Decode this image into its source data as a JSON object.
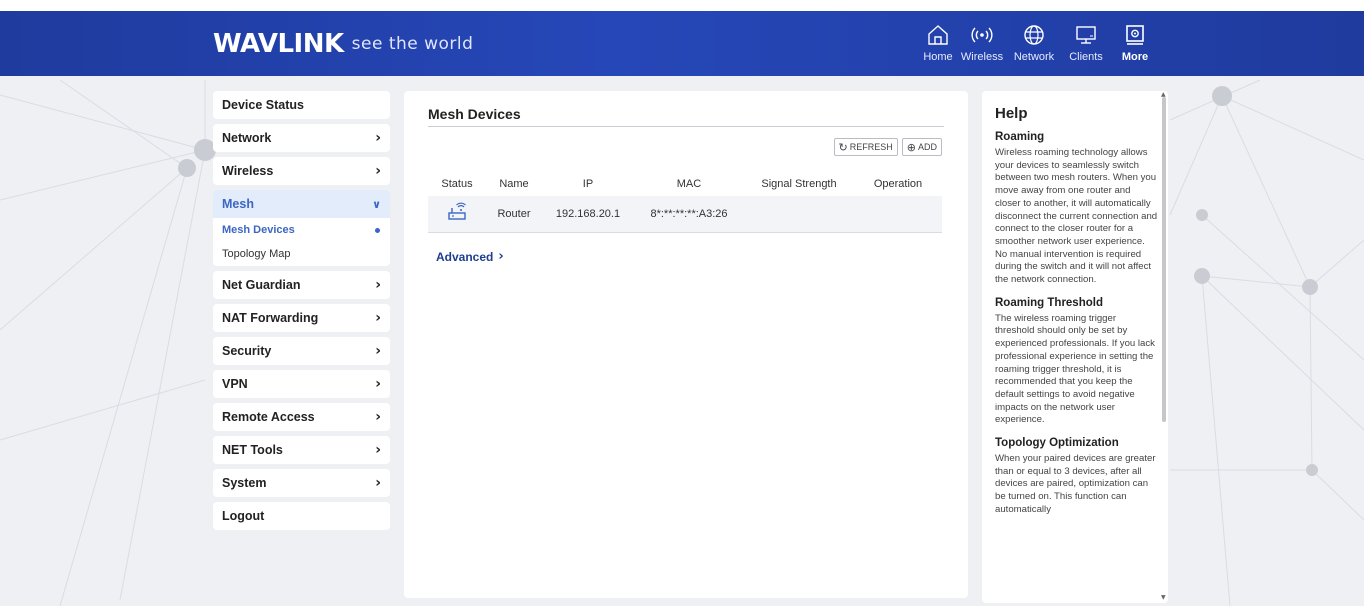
{
  "brand": {
    "logo": "WAVLINK",
    "slogan": "see the world"
  },
  "topnav": [
    {
      "label": "Home",
      "icon": "home-icon",
      "active": false
    },
    {
      "label": "Wireless",
      "icon": "wireless-icon",
      "active": false
    },
    {
      "label": "Network",
      "icon": "globe-icon",
      "active": false
    },
    {
      "label": "Clients",
      "icon": "monitor-icon",
      "active": false
    },
    {
      "label": "More",
      "icon": "more-icon",
      "active": true
    }
  ],
  "sidebar": {
    "device_status": "Device Status",
    "network": "Network",
    "wireless": "Wireless",
    "mesh": "Mesh",
    "mesh_devices": "Mesh Devices",
    "topology_map": "Topology Map",
    "net_guardian": "Net Guardian",
    "nat_forwarding": "NAT Forwarding",
    "security": "Security",
    "vpn": "VPN",
    "remote_access": "Remote Access",
    "net_tools": "NET Tools",
    "system": "System",
    "logout": "Logout"
  },
  "main": {
    "title": "Mesh Devices",
    "refresh_label": "REFRESH",
    "add_label": "ADD",
    "columns": [
      "Status",
      "Name",
      "IP",
      "MAC",
      "Signal Strength",
      "Operation"
    ],
    "rows": [
      {
        "status_icon": "router-icon",
        "name": "Router",
        "ip": "192.168.20.1",
        "mac": "8*:**:**:**:A3:26",
        "signal": "",
        "operation": ""
      }
    ],
    "advanced_label": "Advanced"
  },
  "help": {
    "title": "Help",
    "sections": [
      {
        "heading": "Roaming",
        "text": "Wireless roaming technology allows your devices to seamlessly switch between two mesh routers. When you move away from one router and closer to another, it will automatically disconnect the current connection and connect to the closer router for a smoother network user experience. No manual intervention is required during the switch and it will not affect the network connection."
      },
      {
        "heading": "Roaming Threshold",
        "text": "The wireless roaming trigger threshold should only be set by experienced professionals. If you lack professional experience in setting the roaming trigger threshold, it is recommended that you keep the default settings to avoid negative impacts on the network user experience."
      },
      {
        "heading": "Topology Optimization",
        "text": "When your paired devices are greater than or equal to 3 devices, after all devices are paired, optimization can be turned on. This function can automatically"
      }
    ]
  },
  "colors": {
    "header": "#2243b0",
    "accent": "#3b66c4",
    "link": "#1e3f8f",
    "background": "#eef0f4"
  }
}
